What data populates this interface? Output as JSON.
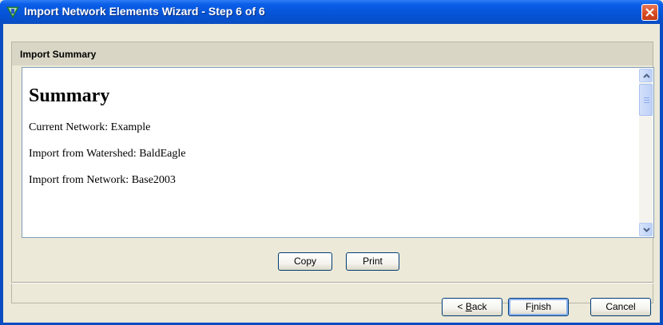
{
  "window": {
    "title": "Import Network Elements Wizard - Step 6 of 6",
    "icon": "network-wizard-icon"
  },
  "group": {
    "header": "Import Summary"
  },
  "summary": {
    "heading": "Summary",
    "lines": [
      "Current Network: Example",
      "Import from Watershed: BaldEagle",
      "Import from Network: Base2003"
    ]
  },
  "actions": {
    "copy": "Copy",
    "print": "Print"
  },
  "footer": {
    "back_prefix": "< ",
    "back_accel": "B",
    "back_rest": "ack",
    "finish_pre": "F",
    "finish_accel": "i",
    "finish_rest": "nish",
    "cancel": "Cancel"
  },
  "colors": {
    "titlebar": "#0a5ee8",
    "window_bg": "#ece9d8",
    "close_button": "#d94d22"
  }
}
